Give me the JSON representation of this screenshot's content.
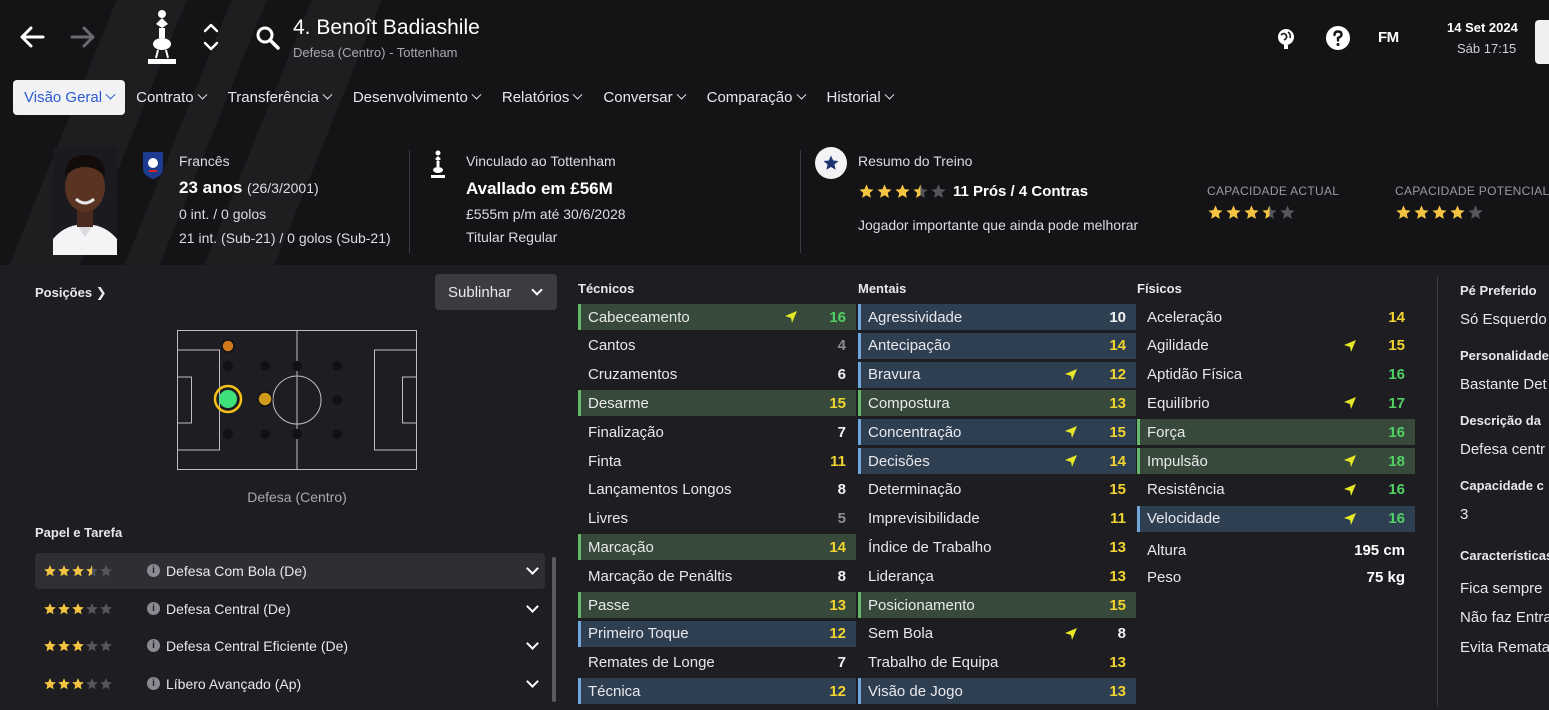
{
  "header": {
    "title": "4. Benoît Badiashile",
    "subtitle": "Defesa (Centro) - Tottenham",
    "date": "14 Set 2024",
    "time": "Sáb 17:15",
    "logo": "FM"
  },
  "tabs": [
    {
      "label": "Visão Geral",
      "active": true
    },
    {
      "label": "Contrato"
    },
    {
      "label": "Transferência"
    },
    {
      "label": "Desenvolvimento"
    },
    {
      "label": "Relatórios"
    },
    {
      "label": "Conversar"
    },
    {
      "label": "Comparação"
    },
    {
      "label": "Historial"
    }
  ],
  "profile": {
    "nationality": "Francês",
    "age": "23 anos",
    "dob": "(26/3/2001)",
    "caps": "0 int. / 0 golos",
    "u21_caps": "21 int. (Sub-21) / 0 golos (Sub-21)",
    "club": "Vinculado ao Tottenham",
    "value": "Avallado em £56M",
    "wage": "£555m p/m até 30/6/2028",
    "status": "Titular Regular"
  },
  "training": {
    "title": "Resumo do Treino",
    "stars": 3.5,
    "pros_cons": "11 Prós / 4 Contras",
    "comment": "Jogador importante que ainda pode melhorar",
    "current_ability_label": "CAPACIDADE ACTUAL",
    "current_ability_stars": 3.5,
    "potential_ability_label": "CAPACIDADE POTENCIAL",
    "potential_ability_stars": 4
  },
  "positions": {
    "label": "Posições",
    "highlight_button": "Sublinhar",
    "position_label": "Defesa (Centro)"
  },
  "roles": {
    "label": "Papel e Tarefa",
    "items": [
      {
        "name": "Defesa Com Bola (De)",
        "stars": 3.5
      },
      {
        "name": "Defesa Central (De)",
        "stars": 3
      },
      {
        "name": "Defesa Central Eficiente (De)",
        "stars": 3
      },
      {
        "name": "Líbero Avançado (Ap)",
        "stars": 3
      }
    ]
  },
  "colors": {
    "grey": "#8d8d95",
    "white": "#f2f2f4",
    "yellow": "#f2d431",
    "green": "#52d064",
    "accent": "#2a5bd1",
    "star": "#f5c542"
  },
  "attributes": {
    "technical": {
      "title": "Técnicos",
      "items": [
        {
          "name": "Cabeceamento",
          "value": "16",
          "hl": "green",
          "arrow": true
        },
        {
          "name": "Cantos",
          "value": "4",
          "hl": ""
        },
        {
          "name": "Cruzamentos",
          "value": "6",
          "hl": ""
        },
        {
          "name": "Desarme",
          "value": "15",
          "hl": "green"
        },
        {
          "name": "Finalização",
          "value": "7",
          "hl": ""
        },
        {
          "name": "Finta",
          "value": "11",
          "hl": ""
        },
        {
          "name": "Lançamentos Longos",
          "value": "8",
          "hl": ""
        },
        {
          "name": "Livres",
          "value": "5",
          "hl": ""
        },
        {
          "name": "Marcação",
          "value": "14",
          "hl": "green"
        },
        {
          "name": "Marcação de Penáltis",
          "value": "8",
          "hl": ""
        },
        {
          "name": "Passe",
          "value": "13",
          "hl": "green"
        },
        {
          "name": "Primeiro Toque",
          "value": "12",
          "hl": "blue"
        },
        {
          "name": "Remates de Longe",
          "value": "7",
          "hl": ""
        },
        {
          "name": "Técnica",
          "value": "12",
          "hl": "blue"
        }
      ]
    },
    "mental": {
      "title": "Mentais",
      "items": [
        {
          "name": "Agressividade",
          "value": "10",
          "hl": "blue"
        },
        {
          "name": "Antecipação",
          "value": "14",
          "hl": "blue"
        },
        {
          "name": "Bravura",
          "value": "12",
          "hl": "blue",
          "arrow": true
        },
        {
          "name": "Compostura",
          "value": "13",
          "hl": "green"
        },
        {
          "name": "Concentração",
          "value": "15",
          "hl": "blue",
          "arrow": true
        },
        {
          "name": "Decisões",
          "value": "14",
          "hl": "blue",
          "arrow": true
        },
        {
          "name": "Determinação",
          "value": "15",
          "hl": ""
        },
        {
          "name": "Imprevisibilidade",
          "value": "11",
          "hl": ""
        },
        {
          "name": "Índice de Trabalho",
          "value": "13",
          "hl": ""
        },
        {
          "name": "Liderança",
          "value": "13",
          "hl": ""
        },
        {
          "name": "Posicionamento",
          "value": "15",
          "hl": "green"
        },
        {
          "name": "Sem Bola",
          "value": "8",
          "hl": "",
          "arrow": true
        },
        {
          "name": "Trabalho de Equipa",
          "value": "13",
          "hl": ""
        },
        {
          "name": "Visão de Jogo",
          "value": "13",
          "hl": "blue"
        }
      ]
    },
    "physical": {
      "title": "Físicos",
      "items": [
        {
          "name": "Aceleração",
          "value": "14",
          "hl": ""
        },
        {
          "name": "Agilidade",
          "value": "15",
          "hl": "",
          "arrow": true
        },
        {
          "name": "Aptidão Física",
          "value": "16",
          "hl": ""
        },
        {
          "name": "Equilíbrio",
          "value": "17",
          "hl": "",
          "arrow": true
        },
        {
          "name": "Força",
          "value": "16",
          "hl": "green"
        },
        {
          "name": "Impulsão",
          "value": "18",
          "hl": "green",
          "arrow": true
        },
        {
          "name": "Resistência",
          "value": "16",
          "hl": "",
          "arrow": true
        },
        {
          "name": "Velocidade",
          "value": "16",
          "hl": "blue",
          "arrow": true
        }
      ],
      "height_label": "Altura",
      "height": "195 cm",
      "weight_label": "Peso",
      "weight": "75 kg"
    }
  },
  "right_panel": {
    "preferred_foot_label": "Pé Preferido",
    "preferred_foot": "Só Esquerdo",
    "personality_label": "Personalidade",
    "personality": "Bastante Det",
    "description_label": "Descrição da",
    "description": "Defesa centr",
    "capacity_label": "Capacidade c",
    "capacity": "3",
    "traits_label": "Características",
    "traits": [
      "Fica sempre",
      "Não faz Entra",
      "Evita Remata"
    ]
  }
}
